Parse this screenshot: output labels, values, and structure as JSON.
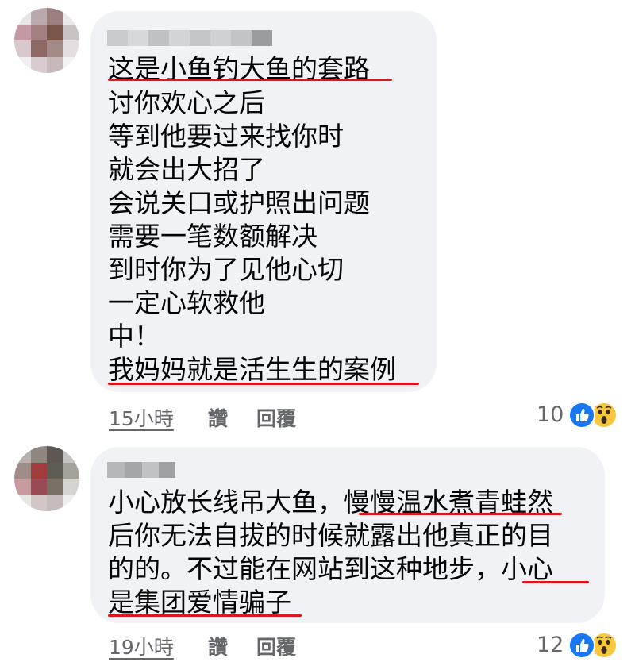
{
  "comments": [
    {
      "lines": [
        "这是小鱼钓大鱼的套路",
        "讨你欢心之后",
        "等到他要过来找你时",
        "就会出大招了",
        "会说关口或护照出问题",
        "需要一笔数额解决",
        "到时你为了见他心切",
        "一定心软救他",
        "中！",
        "我妈妈就是活生生的案例"
      ],
      "time": "15小時",
      "like_label": "讚",
      "reply_label": "回覆",
      "reaction_count": "10"
    },
    {
      "lines": [
        "小心放长线吊大鱼，慢慢温水煮青蛙然",
        "后你无法自拔的时候就露出他真正的目",
        "的的。不过能在网站到这种地步，小心",
        "是集团爱情骗子"
      ],
      "time": "19小時",
      "like_label": "讚",
      "reply_label": "回覆",
      "reaction_count": "12"
    }
  ],
  "icons": {
    "like": "thumbs-up-icon",
    "wow": "wow-face-icon"
  },
  "colors": {
    "bubble": "#f0f2f5",
    "underline": "#e0141e",
    "meta": "#65676b",
    "like": "#1877f2",
    "wow": "#f7c83e"
  }
}
